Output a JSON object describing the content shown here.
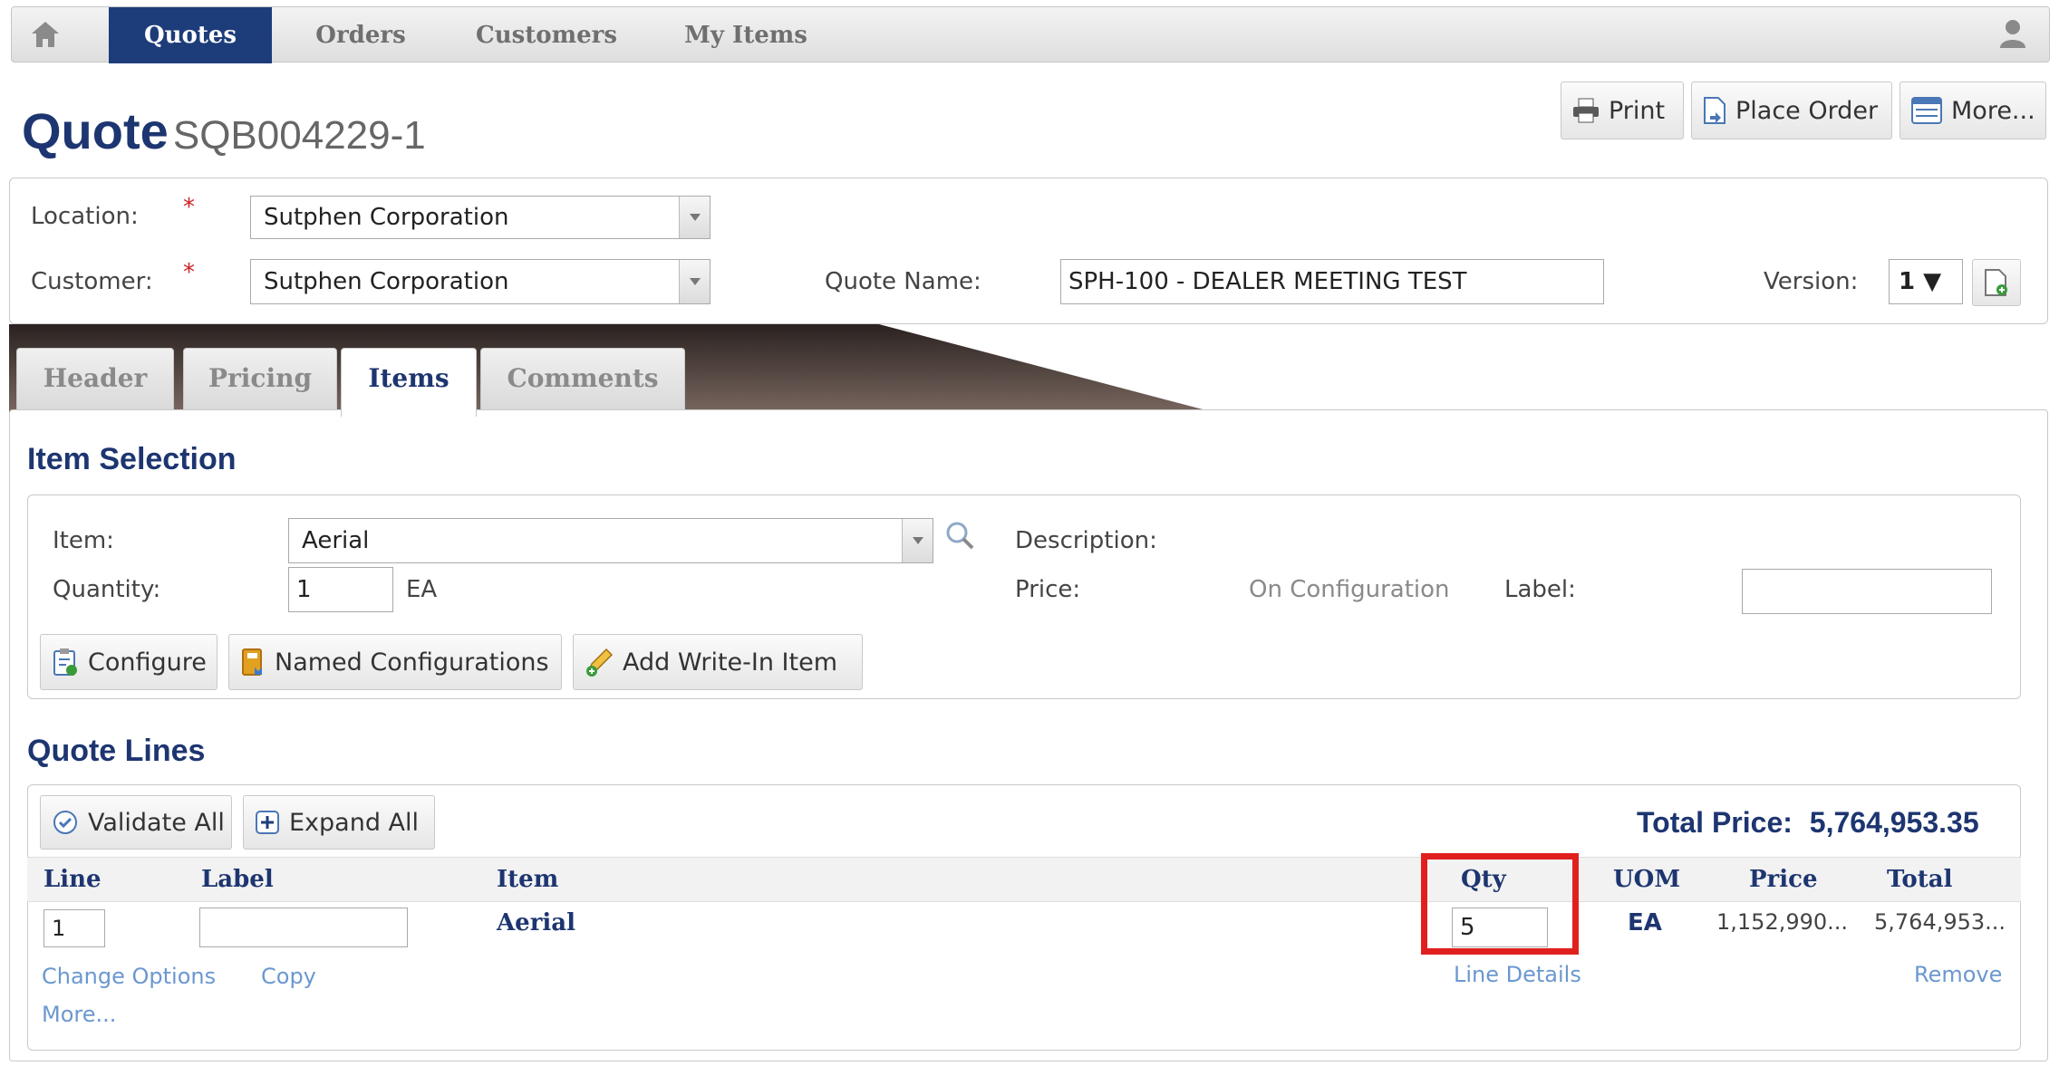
{
  "nav": {
    "tabs": [
      {
        "label": "Quotes",
        "active": true
      },
      {
        "label": "Orders"
      },
      {
        "label": "Customers"
      },
      {
        "label": "My Items"
      }
    ],
    "home_icon": "home-icon",
    "user_icon": "user-icon"
  },
  "actions": {
    "print": "Print",
    "place_order": "Place Order",
    "more": "More..."
  },
  "quote": {
    "title": "Quote",
    "number": "SQB004229-1"
  },
  "header_form": {
    "location_label": "Location:",
    "location_value": "Sutphen Corporation",
    "customer_label": "Customer:",
    "customer_value": "Sutphen Corporation",
    "required_mark": "*",
    "quote_name_label": "Quote Name:",
    "quote_name_value": "SPH-100 - DEALER MEETING TEST",
    "version_label": "Version:",
    "version_value": "1 ▼"
  },
  "tabs": [
    {
      "label": "Header"
    },
    {
      "label": "Pricing"
    },
    {
      "label": "Items",
      "active": true
    },
    {
      "label": "Comments"
    }
  ],
  "item_selection": {
    "title": "Item Selection",
    "item_label": "Item:",
    "item_value": "Aerial",
    "quantity_label": "Quantity:",
    "quantity_value": "1",
    "uom": "EA",
    "description_label": "Description:",
    "price_label": "Price:",
    "price_value": "On Configuration",
    "label_label": "Label:",
    "label_value": "",
    "buttons": {
      "configure": "Configure",
      "named_configurations": "Named Configurations",
      "add_write_in": "Add Write-In Item"
    }
  },
  "quote_lines": {
    "title": "Quote Lines",
    "validate_all": "Validate All",
    "expand_all": "Expand All",
    "total_price_label": "Total Price:",
    "total_price_value": "5,764,953.35",
    "columns": [
      "Line",
      "Label",
      "Item",
      "Qty",
      "UOM",
      "Price",
      "Total"
    ],
    "rows": [
      {
        "line": "1",
        "label": "",
        "item": "Aerial",
        "qty": "5",
        "uom": "EA",
        "price": "1,152,990...",
        "total": "5,764,953...",
        "links": {
          "change_options": "Change Options",
          "copy": "Copy",
          "more": "More...",
          "line_details": "Line Details",
          "remove": "Remove"
        }
      }
    ],
    "highlight_color": "#e0201e"
  },
  "colors": {
    "brand": "#1d3d7a",
    "link": "#6b98cf",
    "required": "#cc2222"
  }
}
